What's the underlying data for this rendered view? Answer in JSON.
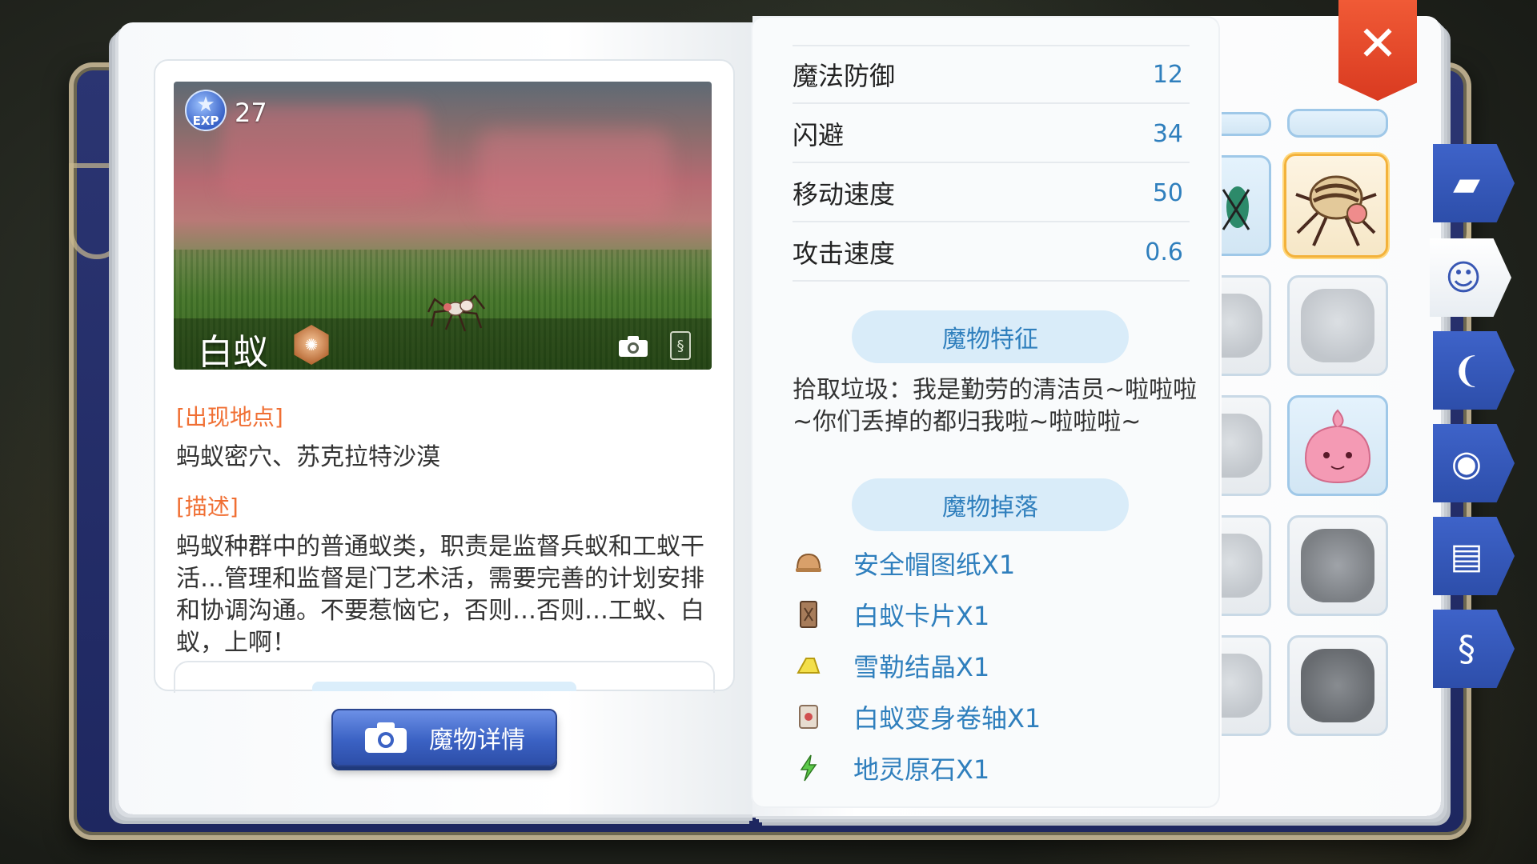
{
  "monster": {
    "exp_label": "EXP",
    "exp": "27",
    "name": "白蚁",
    "location_header": "[出现地点]",
    "location": "蚂蚁密穴、苏克拉特沙漠",
    "description_header": "[描述]",
    "description": "蚂蚁种群中的普通蚁类，职责是监督兵蚁和工蚁干活…管理和监督是门艺术活，需要完善的计划安排和协调沟通。不要惹恼它，否则…否则…工蚁、白蚁，上啊！",
    "detail_button": "魔物详情"
  },
  "stats": [
    {
      "label": "魔法防御",
      "value": "12"
    },
    {
      "label": "闪避",
      "value": "34"
    },
    {
      "label": "移动速度",
      "value": "50"
    },
    {
      "label": "攻击速度",
      "value": "0.6"
    }
  ],
  "feature": {
    "header": "魔物特征",
    "text": "拾取垃圾：我是勤劳的清洁员~啦啦啦~你们丢掉的都归我啦~啦啦啦~"
  },
  "drops": {
    "header": "魔物掉落",
    "items": [
      {
        "name": "安全帽图纸X1",
        "icon": "helmet-blueprint-icon"
      },
      {
        "name": "白蚁卡片X1",
        "icon": "card-icon"
      },
      {
        "name": "雪勒结晶X1",
        "icon": "crystal-icon"
      },
      {
        "name": "白蚁变身卷轴X1",
        "icon": "scroll-icon"
      },
      {
        "name": "地灵原石X1",
        "icon": "earth-stone-icon"
      }
    ]
  },
  "side_tabs": [
    "book-icon",
    "monster-face-icon",
    "horns-icon",
    "head-icon",
    "open-book-icon",
    "card-icon"
  ],
  "close_symbol": "✕",
  "colors": {
    "accent_blue": "#2f7fbd",
    "header_orange": "#f06f33",
    "button_blue": "#3b62c4",
    "close_red": "#e04626"
  }
}
